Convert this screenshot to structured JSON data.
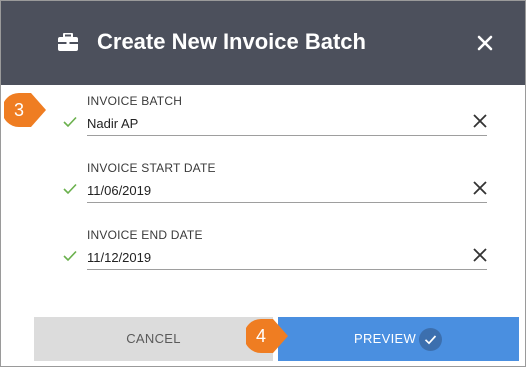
{
  "dialog": {
    "title": "Create New Invoice Batch",
    "header_icon": "briefcase-icon",
    "close_icon": "close-icon"
  },
  "fields": [
    {
      "label": "INVOICE BATCH",
      "value": "Nadir AP"
    },
    {
      "label": "INVOICE START DATE",
      "value": "11/06/2019"
    },
    {
      "label": "INVOICE END DATE",
      "value": "11/12/2019"
    }
  ],
  "buttons": {
    "cancel_label": "CANCEL",
    "preview_label": "PREVIEW"
  },
  "callouts": {
    "step_a": "3",
    "step_b": "4"
  },
  "colors": {
    "header_bg": "#4c505c",
    "primary": "#4a8fe0",
    "callout": "#ef7d22",
    "check": "#6ab04c"
  }
}
